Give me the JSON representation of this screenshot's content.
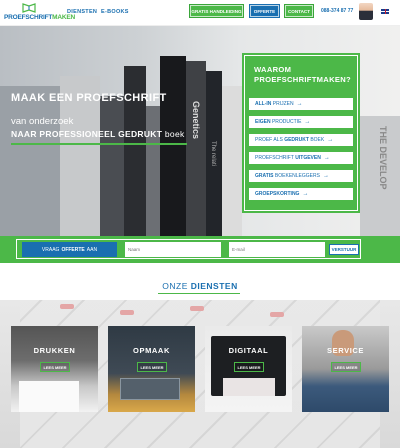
{
  "header": {
    "logo_part1": "PROEFSCHRIFT",
    "logo_part2": "MAKEN",
    "nav": [
      "DIENSTEN",
      "E-BOOKS"
    ],
    "btn_handleiding": "GRATIS HANDLEIDING",
    "btn_offerte": "OFFERTE",
    "btn_contact": "CONTACT",
    "phone": "088-374 87 77",
    "language_icon": "uk-flag-icon"
  },
  "hero": {
    "title": "MAAK EEN PROEFSCHRIFT",
    "line1": "van onderzoek",
    "line2_bold": "NAAR PROFESSIONEEL GEDRUKT",
    "line2_rest": "boek",
    "book_spines": [
      "Genetics",
      "The relati",
      "THE DEVELOP"
    ]
  },
  "why": {
    "title_line1": "WAAROM",
    "title_line2": "PROEFSCHRIFTMAKEN?",
    "items": [
      {
        "bold": "ALL-IN",
        "rest": "PRIJZEN"
      },
      {
        "bold": "EIGEN",
        "rest": "PRODUCTIE"
      },
      {
        "bold": "",
        "pre": "PROEF ALS",
        "bold2": "GEDRUKT",
        "rest": "BOEK"
      },
      {
        "bold": "",
        "pre": "PROEFSCHRIFT",
        "bold2": "UITGEVEN",
        "rest": ""
      },
      {
        "bold": "GRATIS",
        "rest": "BOEKENLEGGERS"
      },
      {
        "bold": "GROEPSKORTING",
        "rest": ""
      }
    ]
  },
  "quote": {
    "btn_pre": "VRAAG",
    "btn_bold": "OFFERTE",
    "btn_post": "AAN",
    "name_placeholder": "Naam",
    "email_placeholder": "E-mail",
    "send": "VERSTUUR"
  },
  "services": {
    "title_pre": "ONZE",
    "title_bold": "DIENSTEN",
    "cards": [
      {
        "title": "DRUKKEN",
        "btn": "LEES MEER"
      },
      {
        "title": "OPMAAK",
        "btn": "LEES MEER"
      },
      {
        "title": "DIGITAAL",
        "btn": "LEES MEER"
      },
      {
        "title": "SERVICE",
        "btn": "LEES MEER"
      }
    ]
  },
  "colors": {
    "green": "#4cb848",
    "blue": "#1a6fb0"
  }
}
